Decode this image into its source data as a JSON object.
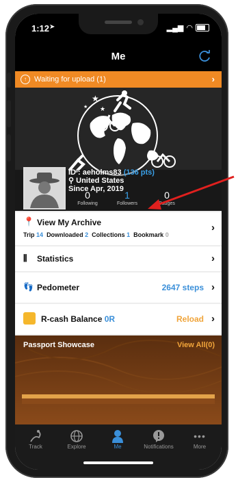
{
  "status_bar": {
    "time": "1:12"
  },
  "nav": {
    "title": "Me"
  },
  "upload_banner": {
    "text": "Waiting for upload (1)"
  },
  "profile": {
    "id_text": "ID : aeholms83",
    "points": "(136 pts)",
    "country": "United States",
    "since": "Since Apr, 2019",
    "stats": [
      {
        "value": "0",
        "label": "Following"
      },
      {
        "value": "1",
        "label": "Followers"
      },
      {
        "value": "0",
        "label": "Badges"
      }
    ]
  },
  "archive": {
    "title": "View My Archive",
    "trip_label": "Trip",
    "trip_count": "14",
    "downloaded_label": "Downloaded",
    "downloaded_count": "2",
    "collections_label": "Collections",
    "collections_count": "1",
    "bookmark_label": "Bookmark",
    "bookmark_count": "0"
  },
  "menu": {
    "statistics": "Statistics",
    "pedometer": "Pedometer",
    "pedometer_value": "2647 steps",
    "rcash_label": "R-cash Balance",
    "rcash_value": "0R",
    "reload": "Reload"
  },
  "passport": {
    "title": "Passport Showcase",
    "view_all": "View All(0)"
  },
  "tabs": [
    {
      "label": "Track",
      "icon": "track-icon"
    },
    {
      "label": "Explore",
      "icon": "globe-icon"
    },
    {
      "label": "Me",
      "icon": "person-icon"
    },
    {
      "label": "Notifications",
      "icon": "notification-icon"
    },
    {
      "label": "More",
      "icon": "more-icon"
    }
  ],
  "colors": {
    "accent_blue": "#3a8fd9",
    "orange": "#f08a24",
    "reload_yellow": "#f0a43a",
    "arrow_red": "#e0201e"
  }
}
